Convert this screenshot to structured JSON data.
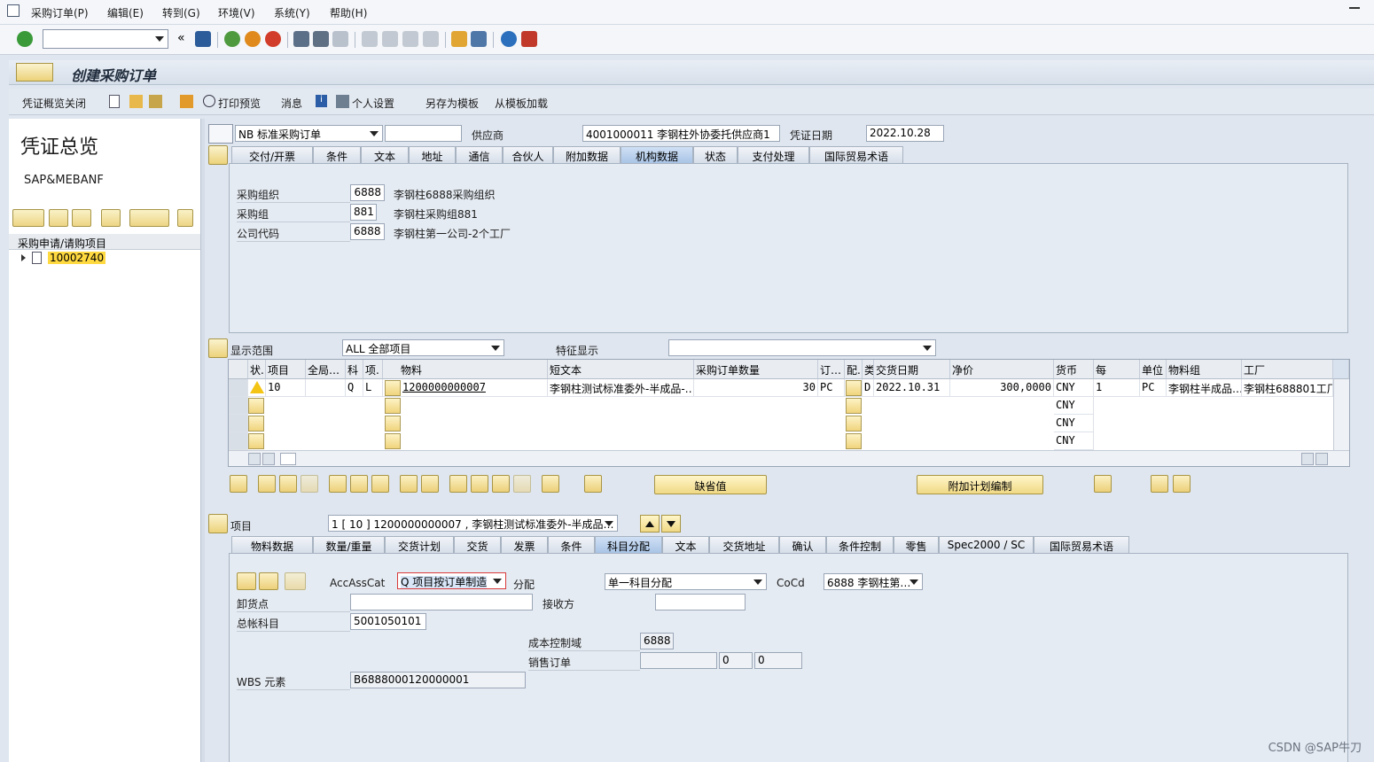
{
  "menu": [
    "采购订单(P)",
    "编辑(E)",
    "转到(G)",
    "环境(V)",
    "系统(Y)",
    "帮助(H)"
  ],
  "title": "创建采购订单",
  "app_toolbar": {
    "doc_overview_close": "凭证概览关闭",
    "print_preview": "打印预览",
    "messages": "消息",
    "personal_settings": "个人设置",
    "save_as_template": "另存为模板",
    "load_from_template": "从模板加载"
  },
  "left_panel": {
    "title": "凭证总览",
    "subtitle": "SAP&MEBANF",
    "column_header": "采购申请/请购项目",
    "tree_item": "10002740"
  },
  "header": {
    "doc_type": "NB 标准采购订单",
    "vendor_label": "供应商",
    "vendor_value": "4001000011 李钢柱外协委托供应商1",
    "doc_date_label": "凭证日期",
    "doc_date_value": "2022.10.28",
    "tabs": [
      "交付/开票",
      "条件",
      "文本",
      "地址",
      "通信",
      "合伙人",
      "附加数据",
      "机构数据",
      "状态",
      "支付处理",
      "国际贸易术语"
    ],
    "active_tab": "机构数据",
    "org": [
      {
        "label": "采购组织",
        "value": "6888",
        "desc": "李钢柱6888采购组织"
      },
      {
        "label": "采购组",
        "value": "881",
        "desc": "李钢柱采购组881"
      },
      {
        "label": "公司代码",
        "value": "6888",
        "desc": "李钢柱第一公司-2个工厂"
      }
    ]
  },
  "items_overview": {
    "display_range_label": "显示范围",
    "display_range_value": "ALL 全部项目",
    "feature_display_label": "特征显示",
    "columns": [
      "状.",
      "项目",
      "全局…",
      "科",
      "项.",
      "物料",
      "短文本",
      "采购订单数量",
      "订…",
      "配.",
      "类",
      "交货日期",
      "净价",
      "货币",
      "每",
      "单位",
      "物料组",
      "工厂"
    ],
    "row1": {
      "item": "10",
      "acct": "Q",
      "cat": "L",
      "material": "1200000000007",
      "short_text": "李钢柱测试标准委外-半成品-…",
      "qty": "30",
      "uom": "PC",
      "date_cat": "D",
      "delivery_date": "2022.10.31",
      "net_price": "300,0000",
      "currency": "CNY",
      "per": "1",
      "unit": "PC",
      "matl_group": "李钢柱半成品…",
      "plant": "李钢柱688801工厂"
    },
    "empty_currency": "CNY",
    "default_values_button": "缺省值",
    "addl_planning_button": "附加计划编制"
  },
  "item_detail": {
    "item_label": "项目",
    "item_value": "1 [ 10 ] 1200000000007 , 李钢柱测试标准委外-半成品…",
    "tabs": [
      "物料数据",
      "数量/重量",
      "交货计划",
      "交货",
      "发票",
      "条件",
      "科目分配",
      "文本",
      "交货地址",
      "确认",
      "条件控制",
      "零售",
      "Spec2000 / SC",
      "国际贸易术语"
    ],
    "active_tab": "科目分配",
    "acc_ass_cat_label": "AccAssCat",
    "acc_ass_cat_value": "Q 项目按订单制造",
    "distribution_label": "分配",
    "distribution_value": "单一科目分配",
    "cocd_label": "CoCd",
    "cocd_value": "6888 李钢柱第…",
    "unloading_point_label": "卸货点",
    "recipient_label": "接收方",
    "gl_account_label": "总帐科目",
    "gl_account_value": "5001050101",
    "co_area_label": "成本控制域",
    "co_area_value": "6888",
    "sales_order_label": "销售订单",
    "sales_order_item": "0",
    "sales_order_sched": "0",
    "wbs_label": "WBS 元素",
    "wbs_value": "B6888000120000001"
  },
  "watermark": "CSDN @SAP牛刀"
}
